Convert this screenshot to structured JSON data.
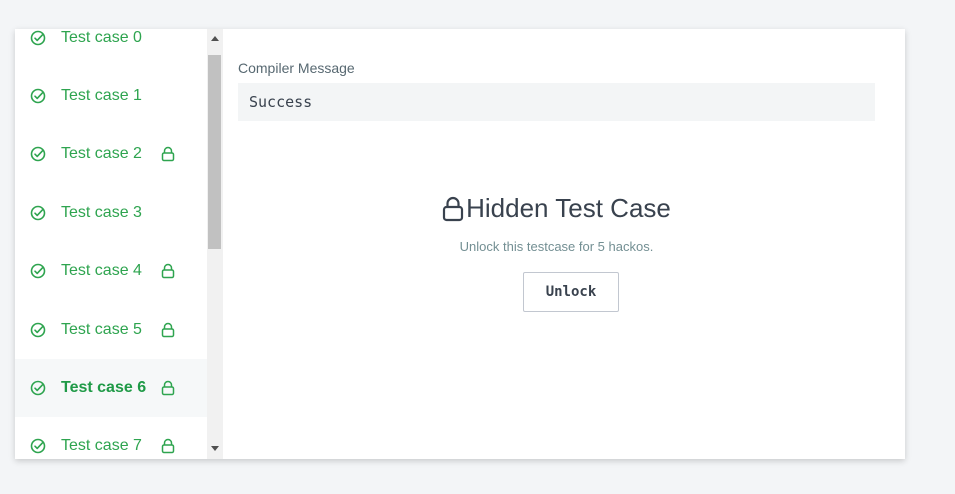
{
  "sidebar": {
    "items": [
      {
        "label": "Test case 0",
        "locked": false,
        "active": false
      },
      {
        "label": "Test case 1",
        "locked": false,
        "active": false
      },
      {
        "label": "Test case 2",
        "locked": true,
        "active": false
      },
      {
        "label": "Test case 3",
        "locked": false,
        "active": false
      },
      {
        "label": "Test case 4",
        "locked": true,
        "active": false
      },
      {
        "label": "Test case 5",
        "locked": true,
        "active": false
      },
      {
        "label": "Test case 6",
        "locked": true,
        "active": true
      },
      {
        "label": "Test case 7",
        "locked": true,
        "active": false
      }
    ]
  },
  "main": {
    "compiler_label": "Compiler Message",
    "compiler_value": "Success",
    "hidden_title": "Hidden Test Case",
    "unlock_description": "Unlock this testcase for 5 hackos.",
    "unlock_button": "Unlock"
  },
  "icons": {
    "check": "check-circle-icon",
    "lock": "lock-icon",
    "scroll_up": "triangle-up-icon",
    "scroll_down": "triangle-down-icon"
  },
  "colors": {
    "success_green": "#2ea44f",
    "text_dark": "#39424e",
    "text_muted": "#738f93",
    "code_bg": "#f3f5f6"
  }
}
